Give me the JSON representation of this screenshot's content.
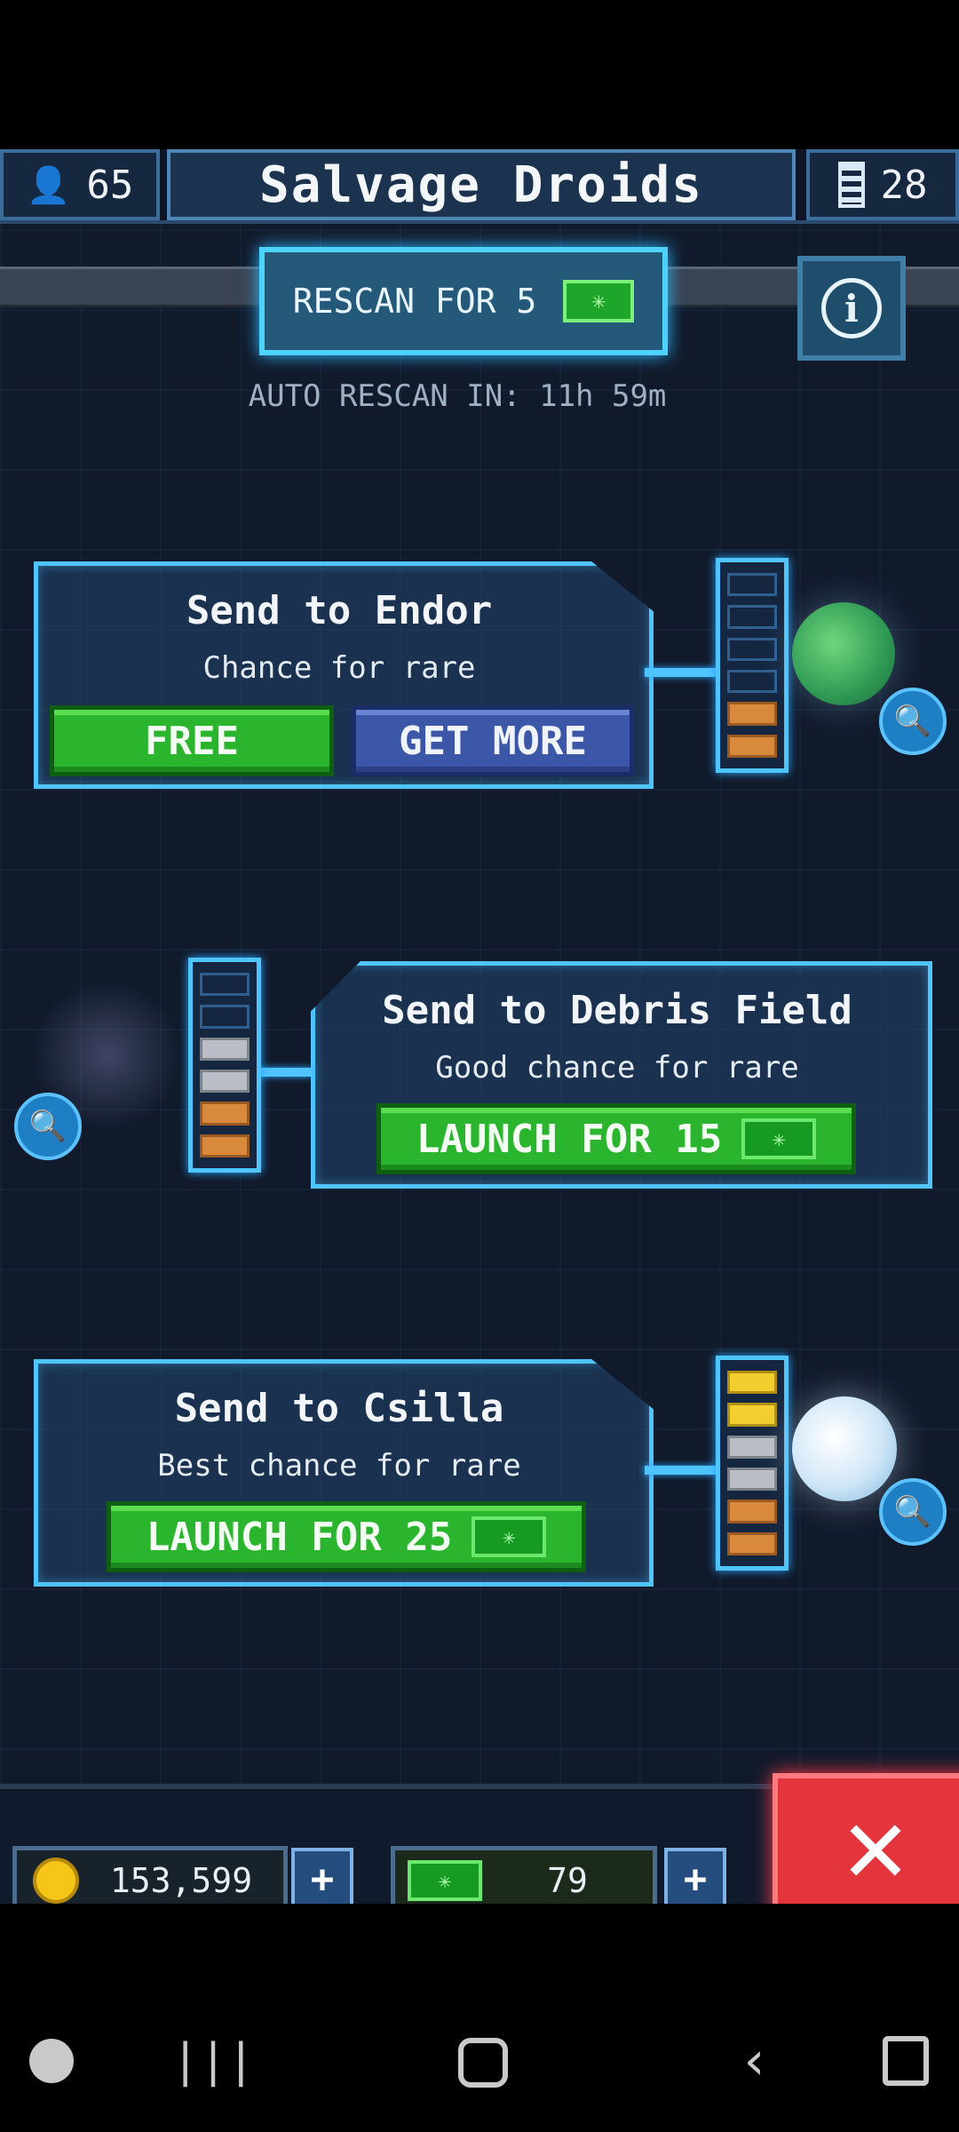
{
  "header": {
    "title": "Salvage Droids",
    "crew_count": "65",
    "droid_count": "28"
  },
  "rescan": {
    "button_label": "RESCAN FOR 5",
    "auto_rescan_text": "AUTO RESCAN IN: 11h 59m"
  },
  "missions": [
    {
      "title": "Send to Endor",
      "subtitle": "Chance for rare",
      "free_label": "FREE",
      "more_label": "GET MORE",
      "meter_filled": 2,
      "meter_total": 6
    },
    {
      "title": "Send to Debris Field",
      "subtitle": "Good chance for rare",
      "launch_label": "LAUNCH FOR 15",
      "meter_filled": 4,
      "meter_total": 6
    },
    {
      "title": "Send to Csilla",
      "subtitle": "Best chance for rare",
      "launch_label": "LAUNCH FOR 25",
      "meter_filled": 6,
      "meter_total": 6
    }
  ],
  "resources": {
    "credits": "153,599",
    "gems": "79",
    "plus_symbol": "+"
  },
  "close_symbol": "✕",
  "icons": {
    "crew": "person-icon",
    "droid": "droid-icon",
    "info": "info-icon",
    "zoom": "magnifier-icon",
    "credit": "coin-icon",
    "gem": "gem-icon"
  },
  "colors": {
    "accent": "#4fc4ff",
    "green_button": "#2bb52e",
    "blue_button": "#3c57a8",
    "close_button": "#e4343c",
    "background": "#111a2b"
  }
}
